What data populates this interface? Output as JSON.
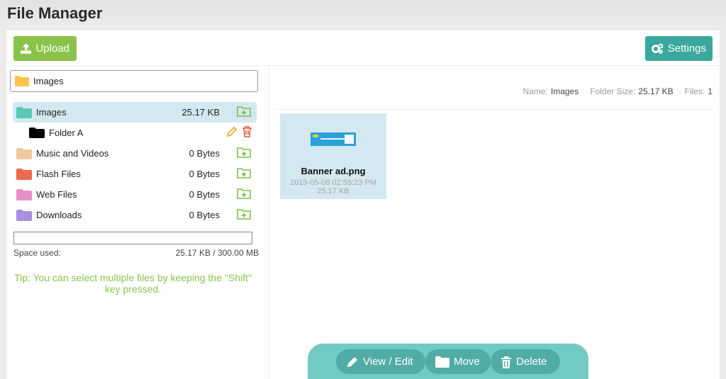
{
  "app": {
    "title": "File Manager"
  },
  "toolbar": {
    "upload_label": "Upload",
    "settings_label": "Settings"
  },
  "breadcrumb": {
    "current": "Images"
  },
  "tree": {
    "folders": [
      {
        "label": "Images",
        "size": "25.17 KB",
        "color": "#5ac9b2",
        "active": true
      },
      {
        "label": "Folder A",
        "color": "#000000",
        "sub": true
      },
      {
        "label": "Music and Videos",
        "size": "0 Bytes",
        "color": "#f0c89d"
      },
      {
        "label": "Flash Files",
        "size": "0 Bytes",
        "color": "#ee6a4e"
      },
      {
        "label": "Web Files",
        "size": "0 Bytes",
        "color": "#ea8ec6"
      },
      {
        "label": "Downloads",
        "size": "0 Bytes",
        "color": "#a890e0"
      }
    ]
  },
  "space": {
    "label": "Space used:",
    "value": "25.17 KB / 300.00 MB",
    "fraction": 0.0001
  },
  "tip": "Tip: You can select multiple files by keeping the \"Shift\" key pressed.",
  "details": {
    "name_label": "Name:",
    "name_value": "Images",
    "size_label": "Folder Size:",
    "size_value": "25.17 KB",
    "files_label": "Files:",
    "files_value": "1"
  },
  "files": [
    {
      "name": "Banner ad.png",
      "date": "2019-05-08 02:55:23 PM",
      "size": "25.17 KB"
    }
  ],
  "actions": {
    "view_edit": "View / Edit",
    "move": "Move",
    "delete": "Delete"
  },
  "colors": {
    "green": "#8bc34a",
    "teal": "#3aa89c",
    "selected": "#d4e8f2",
    "actionbar": "#72cac4"
  }
}
